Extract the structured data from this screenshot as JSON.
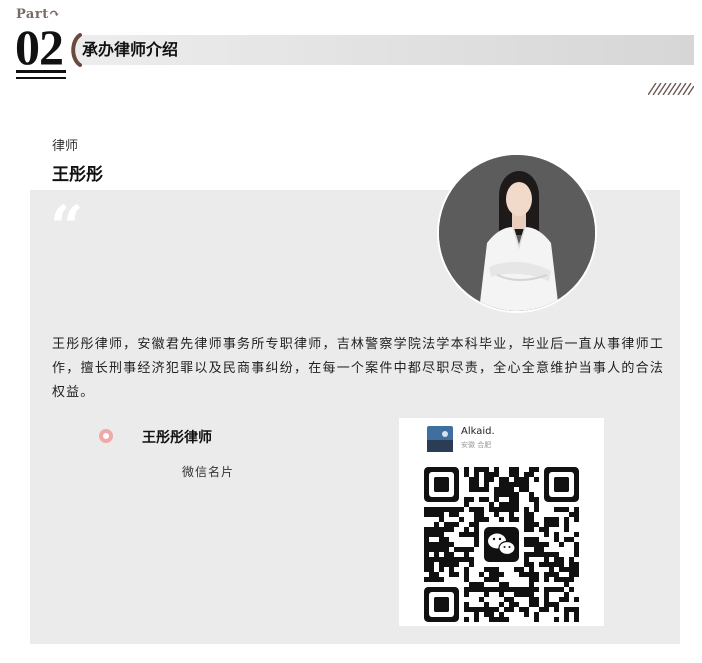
{
  "header": {
    "part_label": "Part",
    "part_number": "02",
    "section_title": "承办律师介绍"
  },
  "lawyer": {
    "role": "律师",
    "name": "王彤彤",
    "description": "王彤彤律师，安徽君先律师事务所专职律师，吉林警察学院法学本科毕业，毕业后一直从事律师工作，擅长刑事经济犯罪以及民商事纠纷，在每一个案件中都尽职尽责，全心全意维护当事人的合法权益。"
  },
  "contact": {
    "card_name": "王彤彤律师",
    "card_subtitle": "微信名片"
  },
  "wechat_card": {
    "username": "Alkaid.",
    "location": "安徽 合肥"
  },
  "colors": {
    "card_background": "#ebebeb",
    "accent_dot": "#f0a8a8",
    "part_label": "#7a6a66",
    "bracket_accent": "#6b4a3e"
  }
}
